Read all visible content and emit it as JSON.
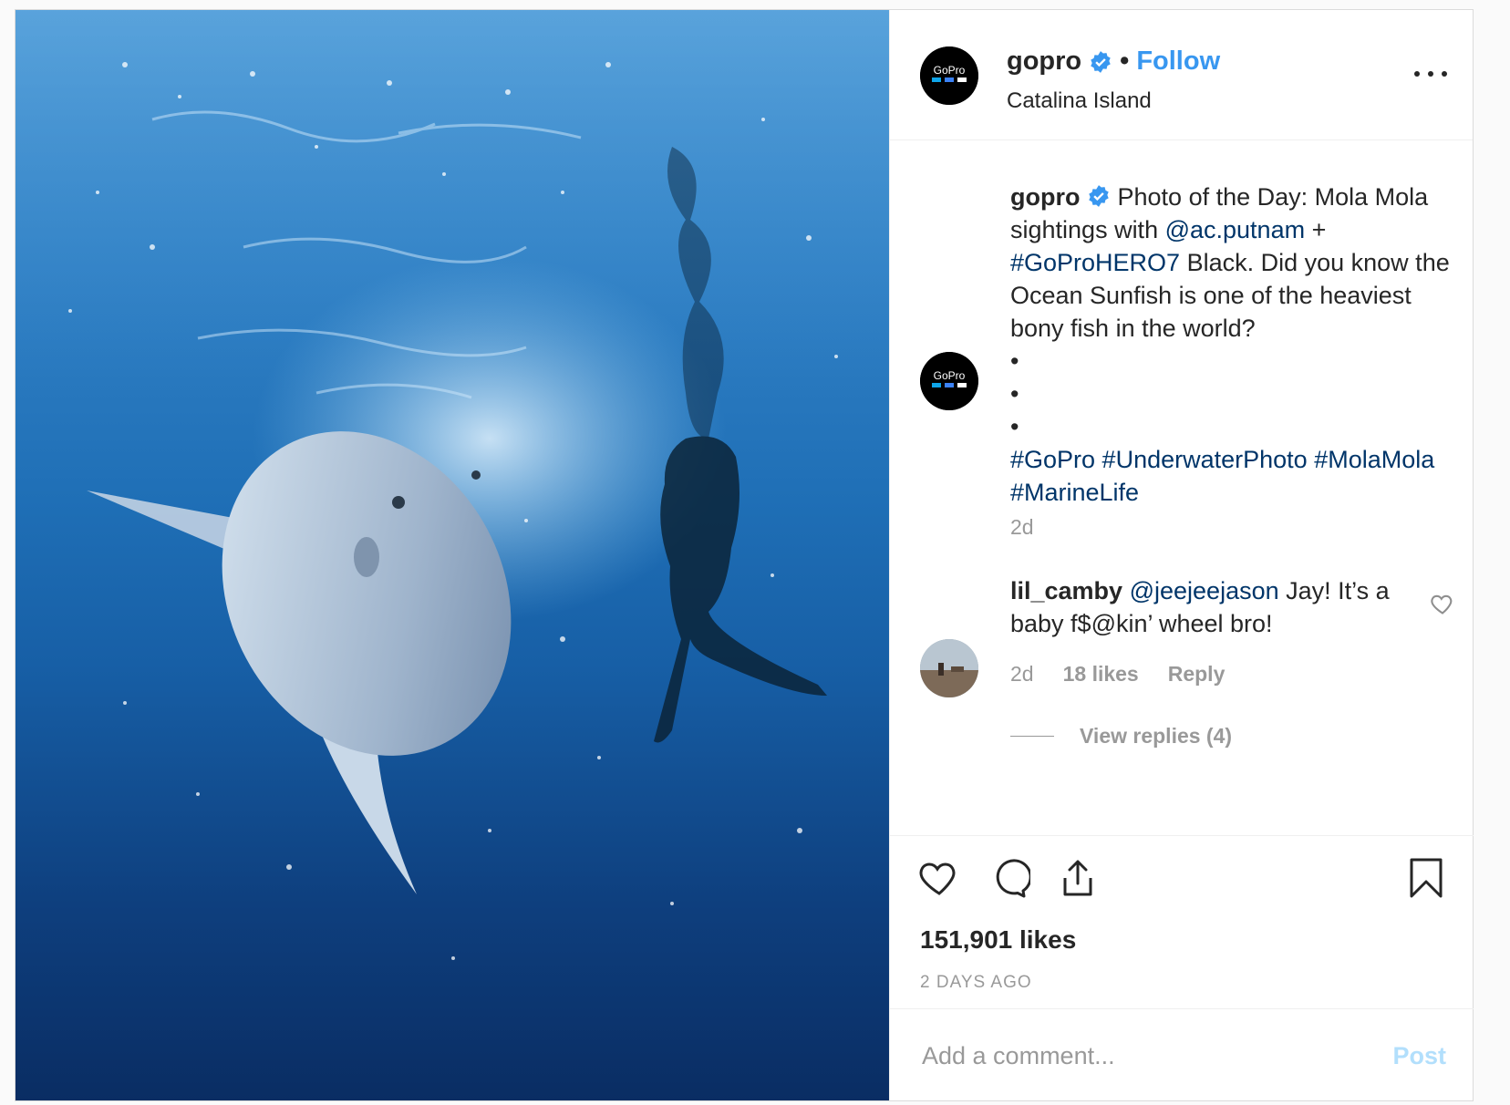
{
  "header": {
    "username": "gopro",
    "separator": "•",
    "follow_label": "Follow",
    "location": "Catalina Island",
    "avatar_icon": "gopro-logo-icon",
    "more_icon": "more-options-icon"
  },
  "caption": {
    "username": "gopro",
    "text_1": "Photo of the Day: Mola Mola sightings with ",
    "mention": "@ac.putnam",
    "text_2": " + ",
    "hashtag_1": "#GoProHERO7",
    "text_3": " Black. Did you know the Ocean Sunfish is one of the heaviest bony fish in the world?",
    "bullets": [
      "•",
      "•",
      "•"
    ],
    "hashtags": "#GoPro #UnderwaterPhoto #MolaMola #MarineLife",
    "time": "2d"
  },
  "comment": {
    "username": "lil_camby",
    "mention": "@jeejeejason",
    "text": " Jay! It’s a baby f$@kin’ wheel bro!",
    "time": "2d",
    "likes": "18 likes",
    "reply_label": "Reply",
    "view_replies": "View replies (4)"
  },
  "actions": {
    "icons": [
      "heart-icon",
      "comment-icon",
      "share-icon",
      "bookmark-icon"
    ],
    "likes": "151,901 likes",
    "posted": "2 DAYS AGO"
  },
  "add_comment": {
    "placeholder": "Add a comment...",
    "post_label": "Post"
  },
  "colors": {
    "link": "#003569",
    "follow": "#3897f0",
    "muted": "#999999",
    "post_disabled": "#b2dffc",
    "verified": "#3897f0"
  }
}
